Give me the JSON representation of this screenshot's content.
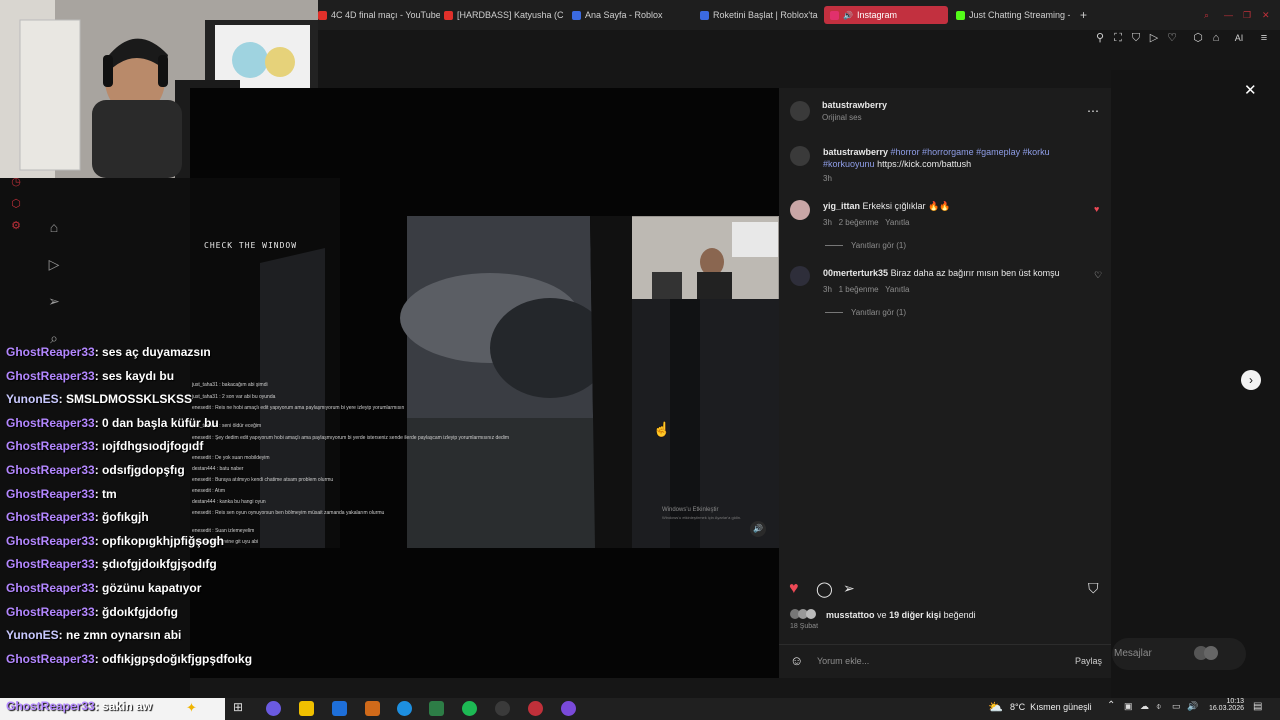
{
  "browser": {
    "tabs": [
      {
        "label": "4C 4D final maçı - YouTube",
        "fav_color": "#e0302a"
      },
      {
        "label": "[HARDBASS] Katyusha (C",
        "fav_color": "#e0302a"
      },
      {
        "label": "Ana Sayfa - Roblox",
        "fav_color": "#3b6ae0"
      },
      {
        "label": "Roketini Başlat | Roblox'ta",
        "fav_color": "#3b6ae0"
      },
      {
        "label": "Instagram",
        "fav_color": "#e1306c",
        "active": true
      },
      {
        "label": "Just Chatting Streaming -",
        "fav_color": "#53fc18"
      }
    ],
    "new_tab": "+"
  },
  "video": {
    "overlay_text": "CHECK THE WINDOW",
    "watermark_title": "Windows'u Etkinleştir",
    "watermark_sub": "Windows'u etkinleştirmek için Ayarlar'a gidin."
  },
  "instagram": {
    "author": "batustrawberry",
    "audio": "Orijinal ses",
    "caption_user": "batustrawberry",
    "caption_tags": "#horror #horrorgame #gameplay #korku",
    "caption_tags2": "#korkuoyunu",
    "caption_link": "https://kick.com/battush",
    "caption_time": "3h",
    "comments": [
      {
        "user": "yig_ittan",
        "text": "Erkeksi çığlıklar 🔥🔥",
        "time": "3h",
        "likes": "2 beğenme",
        "reply": "Yanıtla",
        "view_replies": "Yanıtları gör (1)",
        "liked": true
      },
      {
        "user": "00merterturk35",
        "text": "Biraz daha az bağırır mısın ben üst komşu",
        "time": "3h",
        "likes": "1 beğenme",
        "reply": "Yanıtla",
        "view_replies": "Yanıtları gör (1)",
        "liked": false
      }
    ],
    "liked_by_user": "musstattoo",
    "liked_by_rest": "ve",
    "liked_by_count": "19 diğer kişi",
    "liked_by_suffix": "beğendi",
    "post_date": "18 Şubat",
    "comment_placeholder": "Yorum ekle...",
    "share_label": "Paylaş",
    "messages_label": "Mesajlar"
  },
  "chat": [
    {
      "user": "GhostReaper33",
      "msg": ": ses aç duyamazsın"
    },
    {
      "user": "GhostReaper33",
      "msg": ": ses kaydı bu"
    },
    {
      "user": "YunonES",
      "msg": ": SMSLDMOSSKLSKSS"
    },
    {
      "user": "GhostReaper33",
      "msg": ": 0 dan başla küfür bu"
    },
    {
      "user": "GhostReaper33",
      "msg": ": ıojfdhgsıodjfogıdf"
    },
    {
      "user": "GhostReaper33",
      "msg": ": odsıfjgdopşfıg"
    },
    {
      "user": "GhostReaper33",
      "msg": ": tm"
    },
    {
      "user": "GhostReaper33",
      "msg": ": ğofıkgjh"
    },
    {
      "user": "GhostReaper33",
      "msg": ": opfıkopıgkhjpfiğşogh"
    },
    {
      "user": "GhostReaper33",
      "msg": ": şdıofgjdoıkfgjşodıfg"
    },
    {
      "user": "GhostReaper33",
      "msg": ": gözünu kapatıyor"
    },
    {
      "user": "GhostReaper33",
      "msg": ": ğdoıkfgjdofıg"
    },
    {
      "user": "YunonES",
      "msg": ": ne zmn oynarsın abi"
    },
    {
      "user": "GhostReaper33",
      "msg": ": odfıkjgpşdoğıkfjgpşdfoıkg"
    },
    {
      "user": "GhostReaper33",
      "msg": ": sakin aw"
    }
  ],
  "mini_chat": [
    "just_taha31 : bakacağım abi şimdi",
    "just_taha31 : 2 son var abi bu oyunda",
    "enesedit : Reis ne hobi amaçlı edit yapıyorum ama paylaşmıyorum bi yere izleyip yorumlarmısın",
    "just_taha31 : seni öldür eceğim",
    "enesedit : Şey dedim edit yapıyorum hobi amaçlı ama paylaşmıyorum bi yerde isterseniz sende ilerde paylaşcam izleyip yorumlarmısınız dedim",
    "enesedit : De yok suan mobildeyim",
    "destan444 : batu naber",
    "enesedit : Buraya atılmıyo kendi chatime atsam problem olurmu",
    "enesedit : Atım",
    "destan444 : kanka bu hangi oyun",
    "enesedit : Reis sen oyun oynuyorsun ben bölmeyim müsait zamanda yakalarım olurmu",
    "enesedit : Suan izlemeyelim",
    "just_taha31 : evine git uyu abi"
  ],
  "taskbar": {
    "weather": "8°C",
    "weather_desc": "Kısmen güneşli",
    "time": "10:13",
    "date": "16.03.2026"
  }
}
